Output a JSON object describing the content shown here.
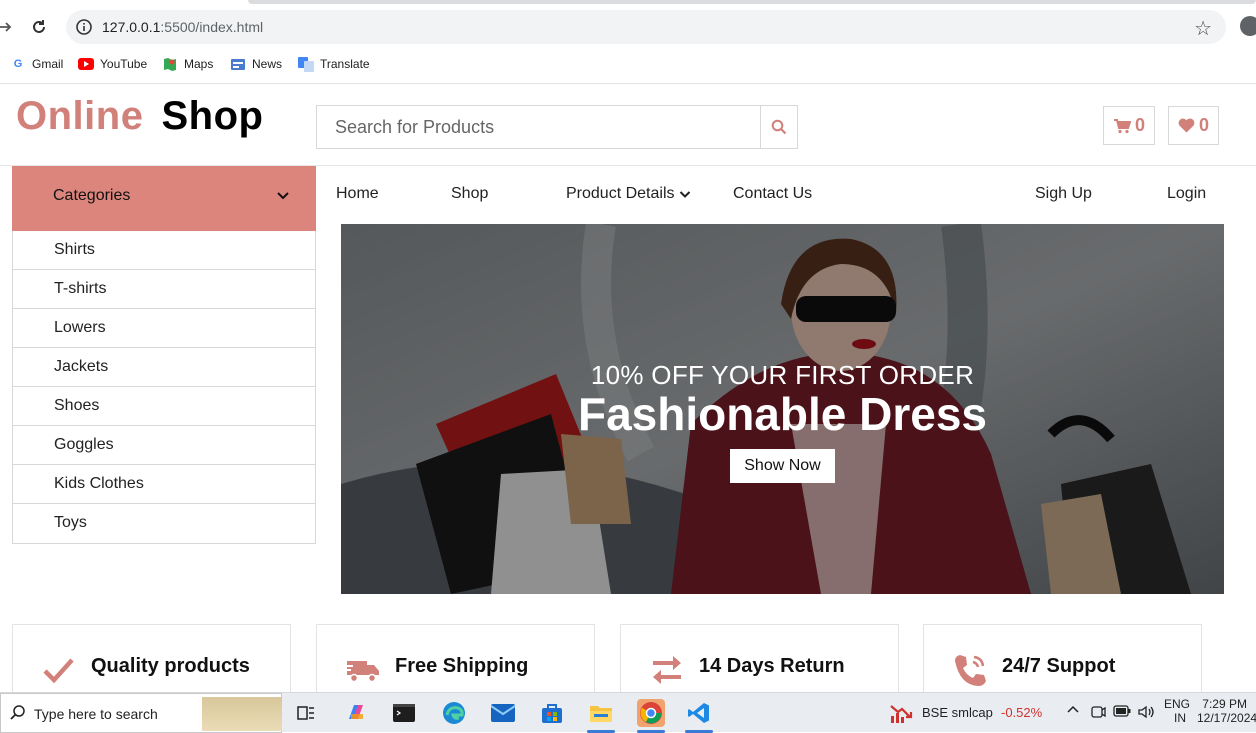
{
  "browser": {
    "url_host": "127.0.0.1",
    "url_path": ":5500/index.html",
    "bookmarks": [
      "Gmail",
      "YouTube",
      "Maps",
      "News",
      "Translate"
    ]
  },
  "header": {
    "logo_part1": "Online",
    "logo_part2": "Shop",
    "search_placeholder": "Search for Products",
    "cart_count": "0",
    "wishlist_count": "0"
  },
  "sidebar": {
    "heading": "Categories",
    "items": [
      "Shirts",
      "T-shirts",
      "Lowers",
      "Jackets",
      "Shoes",
      "Goggles",
      "Kids Clothes",
      "Toys"
    ]
  },
  "nav": {
    "home": "Home",
    "shop": "Shop",
    "product_details": "Product Details",
    "contact": "Contact Us",
    "signup": "Sigh Up",
    "login": "Login"
  },
  "hero": {
    "subtitle": "10% OFF YOUR FIRST ORDER",
    "title": "Fashionable Dress",
    "cta": "Show Now"
  },
  "features": [
    {
      "icon": "check-icon",
      "label": "Quality products"
    },
    {
      "icon": "truck-icon",
      "label": "Free Shipping"
    },
    {
      "icon": "exchange-icon",
      "label": "14 Days Return"
    },
    {
      "icon": "phone-icon",
      "label": "24/7 Suppot"
    }
  ],
  "taskbar": {
    "search_placeholder": "Type here to search",
    "stock_name": "BSE smlcap",
    "stock_change": "-0.52%",
    "lang1": "ENG",
    "lang2": "IN",
    "time": "7:29 PM",
    "date": "12/17/2024"
  },
  "colors": {
    "accent": "#d1807a",
    "category_bg": "#dc857d",
    "stock_negative": "#d0312d"
  }
}
